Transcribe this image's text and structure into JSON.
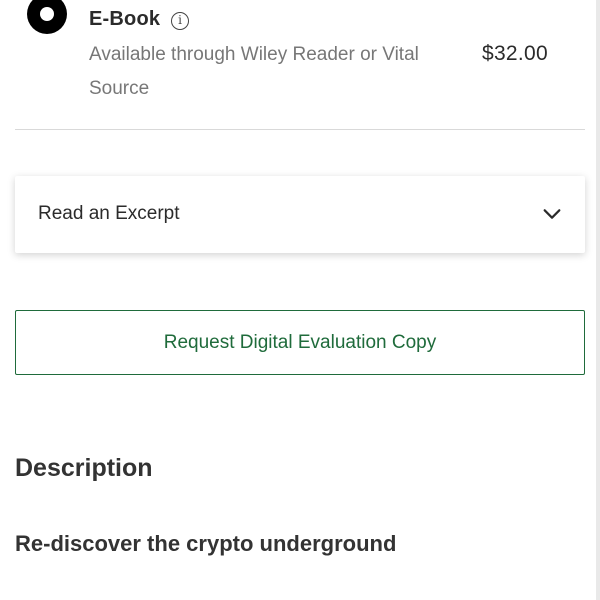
{
  "format_option": {
    "title": "E-Book",
    "info_symbol": "i",
    "description": "Available through Wiley Reader or Vital Source",
    "price": "$32.00",
    "selected": true
  },
  "excerpt": {
    "label": "Read an Excerpt",
    "icon": "chevron-down-icon"
  },
  "request_button": {
    "label": "Request Digital Evaluation Copy"
  },
  "description_section": {
    "heading": "Description",
    "subtitle": "Re-discover the crypto underground"
  },
  "colors": {
    "accent_green": "#1f6b3b",
    "text_dark": "#333333",
    "text_muted": "#777777",
    "divider": "#d9d9d9"
  }
}
